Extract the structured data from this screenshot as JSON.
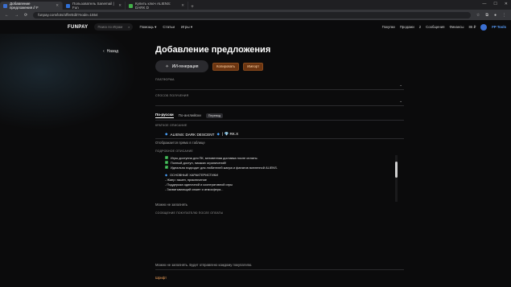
{
  "browser": {
    "tabs": [
      {
        "label": "Добавление предложения // F",
        "color": "#3b6fd1",
        "active": true
      },
      {
        "label": "Пользователь Sanemail | Fun",
        "color": "#2f6fd6",
        "active": false
      },
      {
        "label": "Купить ключ ALIENS: DARK D",
        "color": "#43b14a",
        "active": false
      }
    ],
    "new_tab": "+",
    "window_controls": [
      "—",
      "☐",
      "✕"
    ],
    "url": "funpay.com/lots/offerEdit?node=1554"
  },
  "header": {
    "logo": "FUNPAY",
    "search_placeholder": "Поиск по Играм",
    "nav": [
      "Помощь ▾",
      "Статьи",
      "Игры ▾"
    ],
    "right": {
      "purchases": "Покупки",
      "sales": "Продажи",
      "sales_count": "2",
      "messages": "Сообщения",
      "finance": "Финансы",
      "balance": "86 ₽",
      "fp_tools": "FP Tools"
    }
  },
  "back_label": "Назад",
  "page": {
    "title": "Добавление предложения",
    "ai_button": "ИИ-генерация",
    "copy_button": "Копировать",
    "import_button": "Импорт",
    "platform_label": "ПЛАТФОРМА",
    "method_label": "СПОСОБ ПОЛУЧЕНИЯ",
    "lang_tab_ru": "По-русски",
    "lang_tab_en": "По-английски",
    "translate_button": "Перевод",
    "short_desc_label": "КРАТКОЕ ОПИСАНИЕ",
    "short_desc_text": "ALIENS: DARK DESCENT",
    "short_desc_suffix": "| 💎 RK.X",
    "short_desc_hint": "Отображается прямо в таблице",
    "full_desc_label": "ПОДРОБНОЕ ОПИСАНИЕ",
    "desc_lines": [
      "Игры доступна для ПК, мгновенная доставка после оплаты.",
      "Полный доступ, никаких ограничений!",
      "Идеально подходит для любителей жанра и фанатов вселенной ALIENS."
    ],
    "features_title": "ОСНОВНЫЕ ХАРАКТЕРИСТИКИ",
    "features": [
      "- Жанр: экшен, приключение",
      "- Поддержка одиночной и кооперативной игры",
      "- Захватывающий сюжет и атмосфера..."
    ],
    "full_desc_hint": "Можно не заполнять",
    "buyer_msg_label": "СООБЩЕНИЕ ПОКУПАТЕЛЮ ПОСЛЕ ОПЛАТЫ",
    "buyer_msg_hint": "Можно не заполнять. Будет отправлено каждому покупателю.",
    "bottom_hint": "Шрифт"
  }
}
